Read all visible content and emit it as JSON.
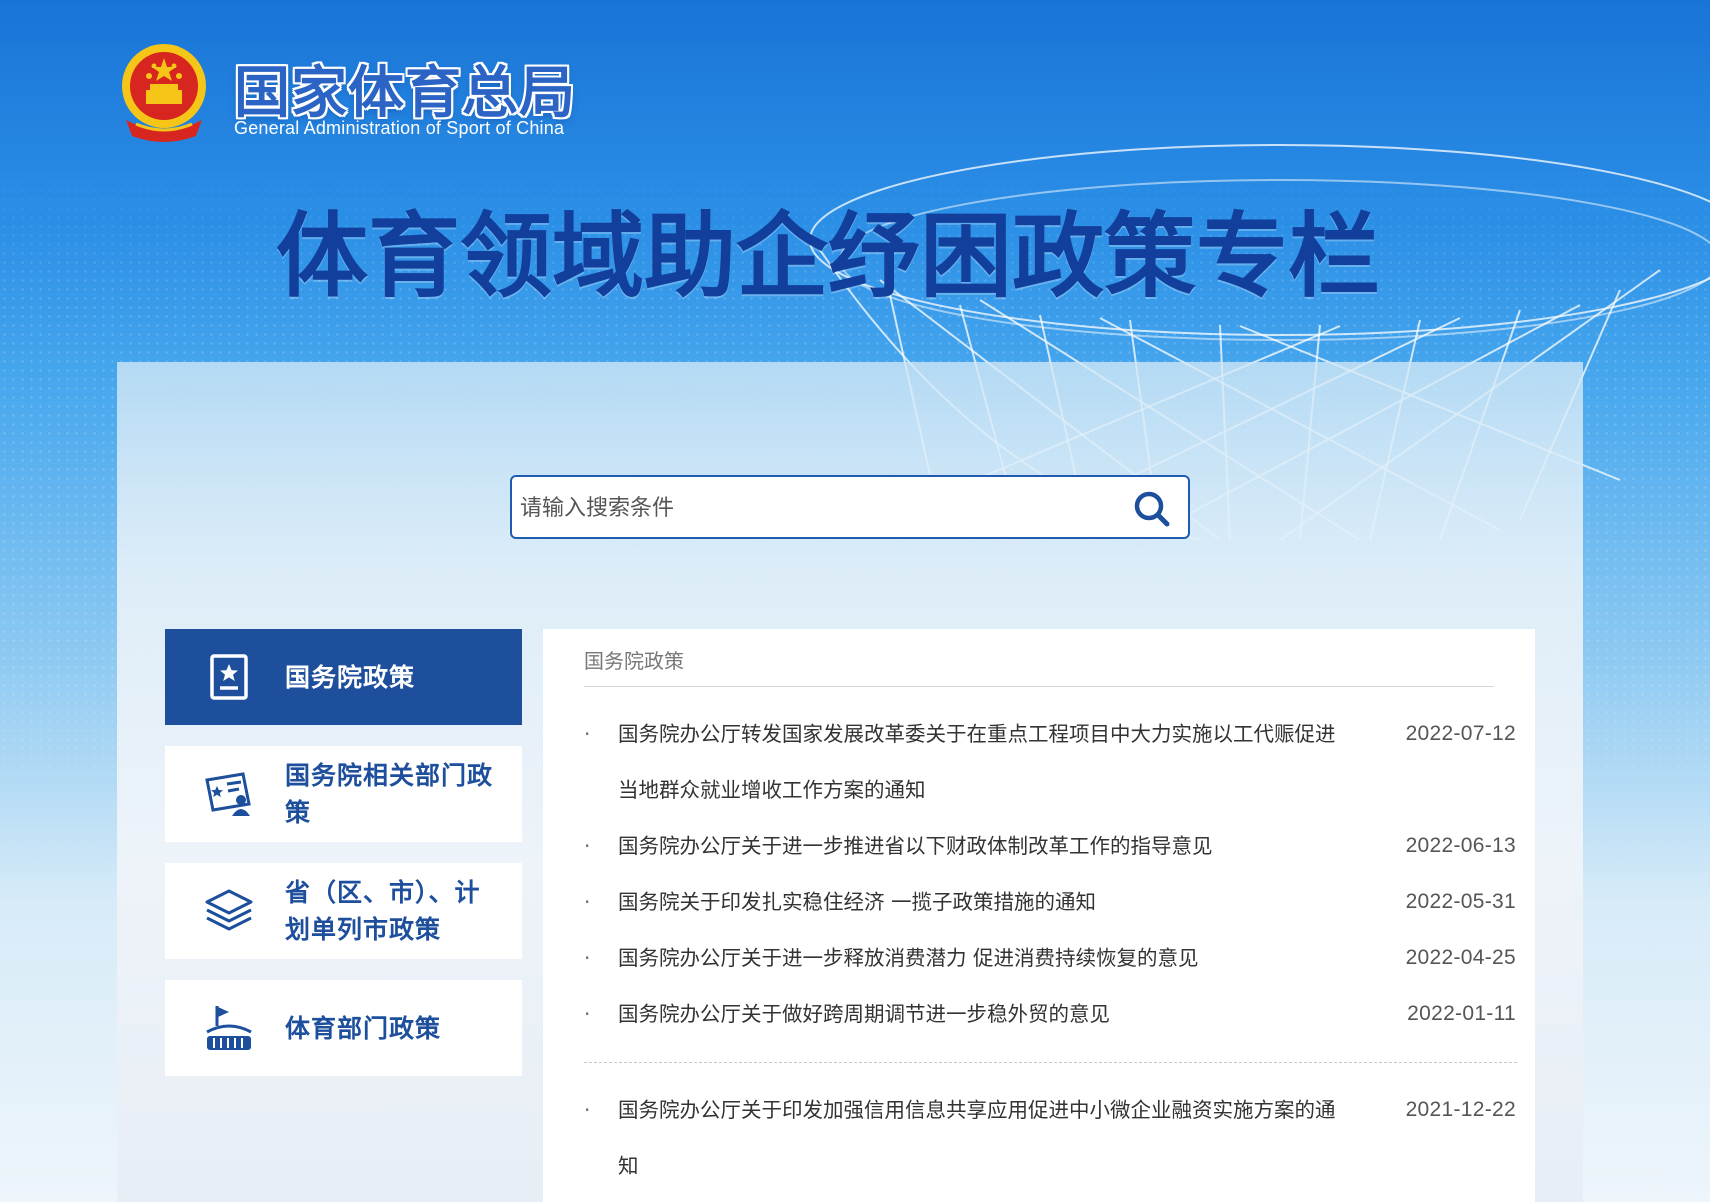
{
  "header": {
    "site_name": "国家体育总局",
    "site_name_en": "General Administration of Sport of China",
    "banner_title": "体育领域助企纾困政策专栏"
  },
  "search": {
    "placeholder": "请输入搜索条件",
    "value": "",
    "button_icon": "search-icon"
  },
  "nav": {
    "items": [
      {
        "label": "国务院政策",
        "icon": "document-star-icon",
        "active": true
      },
      {
        "label": "国务院相关部门政策",
        "icon": "id-card-icon",
        "active": false
      },
      {
        "label": "省（区、市）、计划单列市政策",
        "icon": "layers-icon",
        "active": false
      },
      {
        "label": "体育部门政策",
        "icon": "stadium-flag-icon",
        "active": false
      }
    ]
  },
  "content": {
    "section_title": "国务院政策",
    "items": [
      {
        "title": "国务院办公厅转发国家发展改革委关于在重点工程项目中大力实施以工代赈促进当地群众就业增收工作方案的通知",
        "date": "2022-07-12"
      },
      {
        "title": "国务院办公厅关于进一步推进省以下财政体制改革工作的指导意见",
        "date": "2022-06-13"
      },
      {
        "title": "国务院关于印发扎实稳住经济 一揽子政策措施的通知",
        "date": "2022-05-31"
      },
      {
        "title": "国务院办公厅关于进一步释放消费潜力 促进消费持续恢复的意见",
        "date": "2022-04-25"
      },
      {
        "title": "国务院办公厅关于做好跨周期调节进一步稳外贸的意见",
        "date": "2022-01-11"
      },
      {
        "title": "国务院办公厅关于印发加强信用信息共享应用促进中小微企业融资实施方案的通知",
        "date": "2021-12-22"
      }
    ]
  },
  "colors": {
    "primary": "#1d4f9c",
    "banner_title": "#123f9c",
    "emblem_red": "#d6261f",
    "emblem_gold": "#f5c518"
  }
}
